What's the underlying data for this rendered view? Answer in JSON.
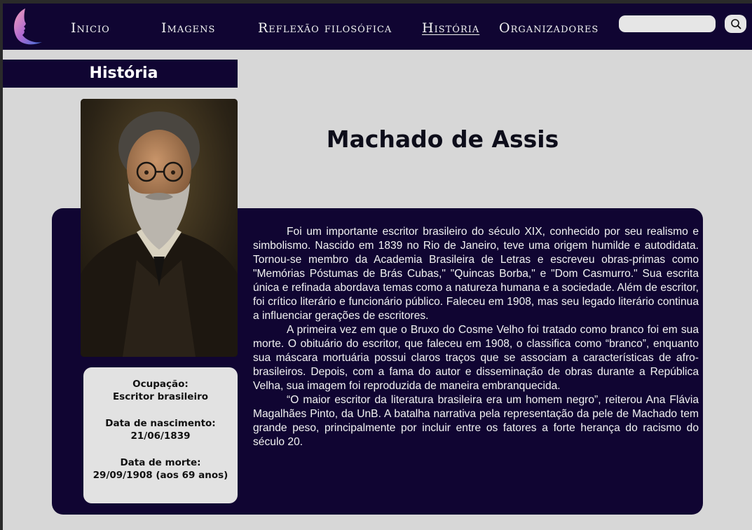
{
  "nav": {
    "items": [
      {
        "label": "Inicio"
      },
      {
        "label": "Imagens"
      },
      {
        "label": "Reflexão filosófica"
      },
      {
        "label": "História"
      },
      {
        "label": "Organizadores"
      }
    ],
    "active_index": 3,
    "search": {
      "placeholder": "",
      "value": ""
    },
    "logo_icon": "face-profile-logo-icon",
    "search_icon": "search-icon"
  },
  "section": {
    "title": "História"
  },
  "person": {
    "name": "Machado de Assis",
    "portrait_icon": "portrait-photo",
    "bio": [
      "Foi um importante escritor brasileiro do século XIX, conhecido por seu realismo e simbolismo. Nascido em 1839 no Rio de Janeiro, teve uma origem humilde e autodidata. Tornou-se membro da Academia Brasileira de Letras e escreveu obras-primas como \"Memórias Póstumas de Brás Cubas,\" \"Quincas Borba,\" e \"Dom Casmurro.\" Sua escrita única e refinada abordava temas como a natureza humana e a sociedade. Além de escritor, foi crítico literário e funcionário público. Faleceu em 1908, mas seu legado literário continua a influenciar gerações de escritores.",
      "A primeira vez em que o Bruxo do Cosme Velho foi tratado como branco foi em sua morte. O obituário do escritor, que faleceu em 1908, o classifica como “branco”, enquanto sua máscara mortuária possui claros traços que se associam a características de afro-brasileiros. Depois, com a fama do autor e disseminação de obras durante a República Velha, sua imagem foi reproduzida de maneira embranquecida.",
      "“O maior escritor da literatura brasileira era um homem negro”, reiterou Ana Flávia Magalhães Pinto, da UnB. A batalha narrativa pela representação da pele de Machado tem grande peso, principalmente por incluir entre os fatores a forte herança do racismo do século 20."
    ],
    "info": {
      "occupation_label": "Ocupação:",
      "occupation_value": "Escritor brasileiro",
      "birth_label": "Data de nascimento:",
      "birth_value": "21/06/1839",
      "death_label": "Data de morte:",
      "death_value": "29/09/1908 (aos 69 anos)"
    }
  },
  "colors": {
    "navy": "#100532",
    "page_bg": "#d7d7d7",
    "card_bg": "#e2e2e2",
    "text_light": "#f3f3f3"
  }
}
